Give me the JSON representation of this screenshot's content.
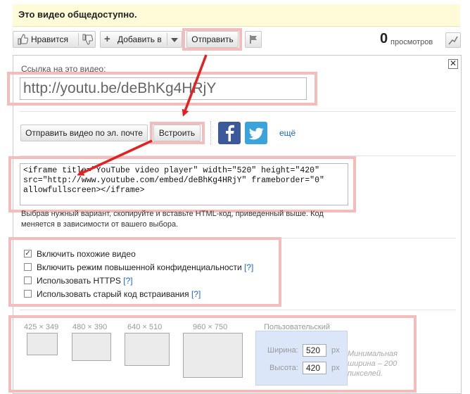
{
  "notice": "Это видео общедоступно.",
  "toolbar": {
    "like": "Нравится",
    "add": "Добавить в",
    "share": "Отправить",
    "views_count": "0",
    "views_label": "просмотров"
  },
  "share_panel": {
    "close": "✕",
    "link_label": "Ссылка на это видео:",
    "link_url": "http://youtu.be/deBhKg4HRjY",
    "email_button": "Отправить видео по эл. почте",
    "embed_button": "Встроить",
    "more_link": "ещё"
  },
  "embed": {
    "code": "<iframe title=\"YouTube video player\" width=\"520\" height=\"420\"\nsrc=\"http://www.youtube.com/embed/deBhKg4HRjY\" frameborder=\"0\"\nallowfullscreen></iframe>",
    "help_text": "Выбрав нужный вариант, скопируйте и вставьте HTML-код, приведенный выше. Код меняется в зависимости от вашего выбора."
  },
  "options": [
    {
      "label": "Включить похожие видео",
      "checked": true,
      "help": ""
    },
    {
      "label": "Включить режим повышенной конфиденциальности",
      "checked": false,
      "help": "[?]"
    },
    {
      "label": "Использовать HTTPS",
      "checked": false,
      "help": "[?]"
    },
    {
      "label": "Использовать старый код встраивания",
      "checked": false,
      "help": "[?]"
    }
  ],
  "sizes": [
    {
      "label": "425 × 349"
    },
    {
      "label": "480 × 390"
    },
    {
      "label": "640 × 510"
    },
    {
      "label": "960 × 750"
    }
  ],
  "custom_size": {
    "title": "Пользовательский",
    "width_label": "Ширина:",
    "width_value": "520",
    "height_label": "Высота:",
    "height_value": "420",
    "unit": "px",
    "min_note": "Минимальная ширина – 200 пикселей."
  },
  "colors": {
    "highlight": "#f5bcbc",
    "arrow": "#e52020",
    "link": "#1b68c4",
    "notice_bg": "#fffbd8"
  }
}
